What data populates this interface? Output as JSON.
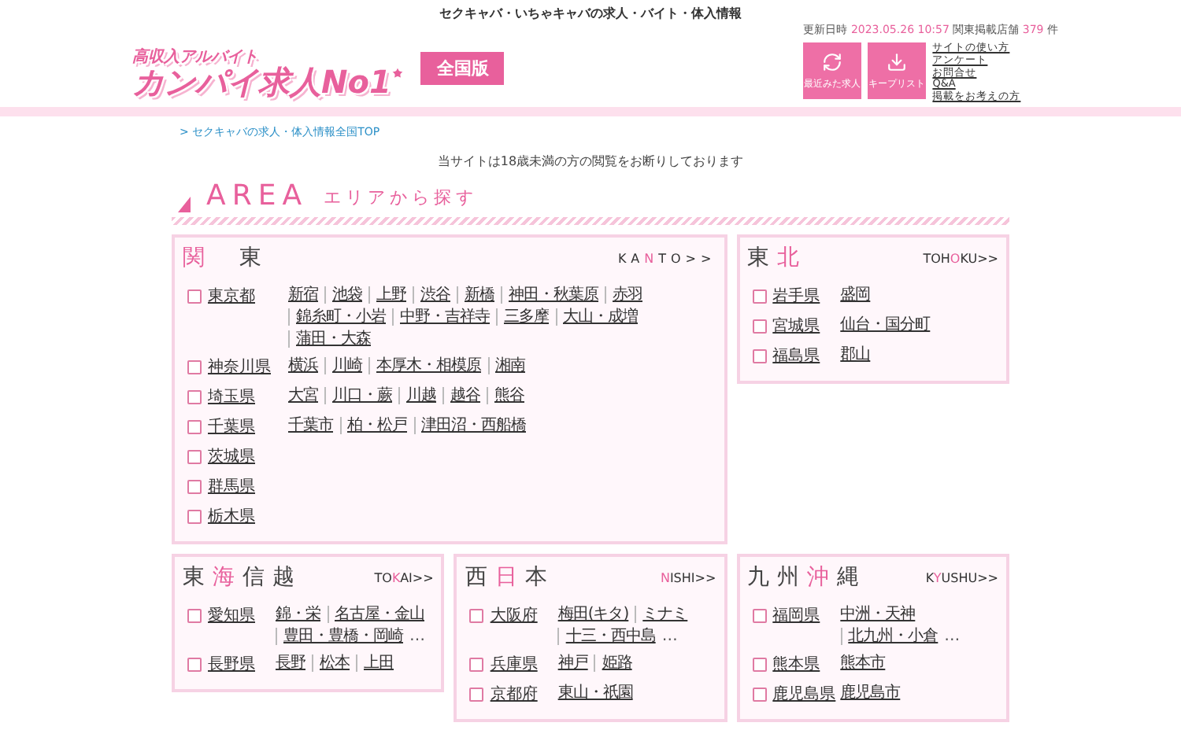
{
  "top_tagline": "セクキャバ・いちゃキャバの求人・バイト・体入情報",
  "logo": {
    "tagline": "高収入アルバイト",
    "name": "カンパイ求人No1"
  },
  "edition_badge": "全国版",
  "update_info": {
    "label": "更新日時",
    "timestamp": "2023.05.26 10:57",
    "count_label": "関東掲載店舗",
    "count": "379",
    "unit": "件"
  },
  "header_buttons": [
    {
      "label": "最近みた求人",
      "kind": "history"
    },
    {
      "label": "キープリスト",
      "kind": "keep"
    }
  ],
  "header_links": [
    "サイトの使い方",
    "アンケート",
    "お問合せ",
    "Q&A",
    "掲載をお考えの方"
  ],
  "breadcrumb": "> セクキャバの求人・体入情報全国TOP",
  "notice": "当サイトは18歳未満の方の閲覧をお断りしております",
  "area_heading": {
    "title": "AREA",
    "subtitle": "エリアから探す"
  },
  "regions": [
    {
      "title": [
        {
          "text": "関",
          "highlight": true
        },
        {
          "text": "東",
          "highlight": false
        }
      ],
      "romaji": {
        "before": "KA",
        "accent": "N",
        "after": "TO>>"
      },
      "prefectures": [
        {
          "name": "東京都",
          "checked": false,
          "links": [
            "新宿",
            "池袋",
            "上野",
            "渋谷",
            "新橋",
            "神田・秋葉原",
            "赤羽",
            "錦糸町・小岩",
            "中野・吉祥寺",
            "三多摩",
            "大山・成増",
            "蒲田・大森"
          ]
        },
        {
          "name": "神奈川県",
          "checked": false,
          "links": [
            "横浜",
            "川崎",
            "本厚木・相模原",
            "湘南"
          ]
        },
        {
          "name": "埼玉県",
          "checked": false,
          "links": [
            "大宮",
            "川口・蕨",
            "川越",
            "越谷",
            "熊谷"
          ]
        },
        {
          "name": "千葉県",
          "checked": false,
          "links": [
            "千葉市",
            "柏・松戸",
            "津田沼・西船橋"
          ]
        },
        {
          "name": "茨城県",
          "checked": false
        },
        {
          "name": "群馬県",
          "checked": false
        },
        {
          "name": "栃木県",
          "checked": false
        }
      ]
    },
    {
      "title": [
        {
          "text": "東",
          "highlight": false
        },
        {
          "text": "北",
          "highlight": true
        }
      ],
      "romaji": {
        "before": "TOH",
        "accent": "O",
        "after": "KU>>"
      },
      "prefectures": [
        {
          "name": "岩手県",
          "checked": false,
          "links": [
            "盛岡"
          ]
        },
        {
          "name": "宮城県",
          "checked": false,
          "links": [
            "仙台・国分町"
          ]
        },
        {
          "name": "福島県",
          "checked": false,
          "links": [
            "郡山"
          ]
        }
      ]
    },
    {
      "title": [
        {
          "text": "東",
          "highlight": false
        },
        {
          "text": "海",
          "highlight": true
        },
        {
          "text": "信",
          "highlight": false
        },
        {
          "text": "越",
          "highlight": false
        }
      ],
      "romaji": {
        "before": "TO",
        "accent": "K",
        "after": "AI>>"
      },
      "prefectures": [
        {
          "name": "愛知県",
          "checked": false,
          "links": [
            "錦・栄",
            "名古屋・金山",
            "豊田・豊橋・岡崎"
          ],
          "more": "…"
        },
        {
          "name": "長野県",
          "checked": false,
          "links": [
            "長野",
            "松本",
            "上田"
          ]
        }
      ]
    },
    {
      "title": [
        {
          "text": "西",
          "highlight": false
        },
        {
          "text": "日",
          "highlight": true
        },
        {
          "text": "本",
          "highlight": false
        }
      ],
      "romaji": {
        "accent": "N",
        "after": "ISHI>>"
      },
      "prefectures": [
        {
          "name": "大阪府",
          "checked": false,
          "links": [
            "梅田(キタ)",
            "ミナミ",
            "十三・西中島"
          ],
          "more": "…"
        },
        {
          "name": "兵庫県",
          "checked": false,
          "links": [
            "神戸",
            "姫路"
          ]
        },
        {
          "name": "京都府",
          "checked": false,
          "links": [
            "東山・祇園"
          ]
        }
      ]
    },
    {
      "title": [
        {
          "text": "九",
          "highlight": false
        },
        {
          "text": "州",
          "highlight": false
        },
        {
          "text": "沖",
          "highlight": true
        },
        {
          "text": "縄",
          "highlight": false
        }
      ],
      "romaji": {
        "before": "K",
        "accent": "Y",
        "after": "USHU>>"
      },
      "prefectures": [
        {
          "name": "福岡県",
          "checked": false,
          "links": [
            "中洲・天神",
            "北九州・小倉"
          ],
          "more": "…"
        },
        {
          "name": "熊本県",
          "checked": false,
          "links": [
            "熊本市"
          ]
        },
        {
          "name": "鹿児島県",
          "checked": false,
          "links": [
            "鹿児島市"
          ]
        }
      ]
    }
  ]
}
